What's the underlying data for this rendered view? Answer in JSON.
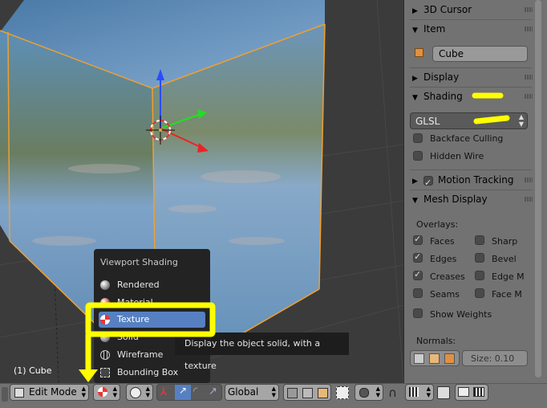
{
  "viewport": {
    "object_label": "(1) Cube"
  },
  "properties": {
    "panels": [
      {
        "label": "3D Cursor",
        "expanded": false
      },
      {
        "label": "Item",
        "expanded": true
      },
      {
        "label": "Display",
        "expanded": false
      },
      {
        "label": "Shading",
        "expanded": true
      },
      {
        "label": "Motion Tracking",
        "expanded": false,
        "checked": true
      },
      {
        "label": "Mesh Display",
        "expanded": true
      }
    ],
    "item_name": "Cube",
    "shading_mode": "GLSL",
    "backface_culling": {
      "label": "Backface Culling",
      "checked": false
    },
    "hidden_wire": {
      "label": "Hidden Wire",
      "checked": false
    },
    "overlays_label": "Overlays:",
    "overlays": [
      {
        "label": "Faces",
        "checked": true
      },
      {
        "label": "Sharp",
        "checked": false
      },
      {
        "label": "Edges",
        "checked": true
      },
      {
        "label": "Bevel",
        "checked": false
      },
      {
        "label": "Creases",
        "checked": true
      },
      {
        "label": "Edge M",
        "checked": false
      },
      {
        "label": "Seams",
        "checked": false
      },
      {
        "label": "Face M",
        "checked": false
      },
      {
        "label": "Show Weights",
        "checked": false
      }
    ],
    "normals_label": "Normals:",
    "normals_size": "Size:  0.10"
  },
  "menu": {
    "title": "Viewport Shading",
    "items": [
      "Rendered",
      "Material",
      "Texture",
      "Solid",
      "Wireframe",
      "Bounding Box"
    ],
    "selected": "Texture",
    "tooltip": "Display the object solid, with a texture"
  },
  "header": {
    "mode": "Edit Mode",
    "orientation": "Global"
  },
  "colors": {
    "selection_orange": "#f0a030",
    "highlight_yellow": "#ffff00",
    "menu_selected": "#5680c2"
  }
}
